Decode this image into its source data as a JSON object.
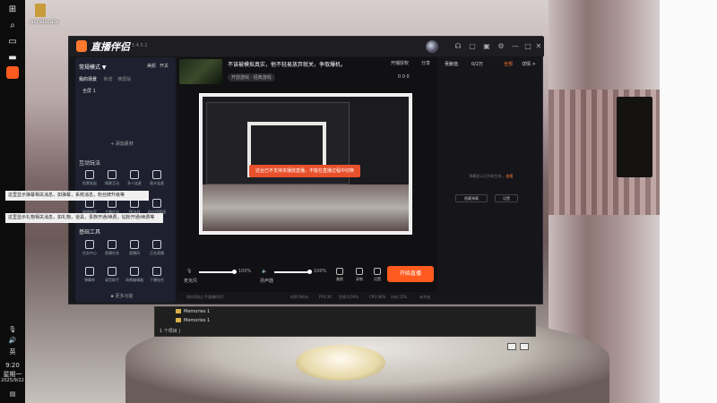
{
  "desktop": {
    "file_label": ".accelerate"
  },
  "taskbar": {
    "time": "9:20",
    "weekday": "星期一",
    "date": "2025/9/22",
    "lang": "英"
  },
  "app": {
    "name": "直播伴侣",
    "version": "5.4.5.2",
    "mode_label": "常规模式 ▼",
    "beauty_label": "美颜",
    "settings_label": "开关",
    "scene_tabs": [
      "我的场景",
      "新增",
      "横屏版"
    ],
    "scene_item": "全屏 1",
    "add_material": "+ 添加素材",
    "interactive_title": "互动玩法",
    "interactive_tools": [
      "投票发起",
      "情景互动",
      "多人连麦",
      "观众连麦",
      "福袋抽奖",
      "主播任务",
      "PK连线",
      "粉丝团管理"
    ],
    "basic_tools_title": "基础工具",
    "basic_tools": [
      "任务中心",
      "直播任务",
      "直播间",
      "正在直播",
      "弹幕库",
      "录音助手",
      "场景编辑器",
      "下播电台"
    ],
    "more_features": "▪ 更多功能",
    "stream_title": "不该被模拟真实，他不轻易放弃就关，争取爆机。",
    "category_tag": "开放游戏 · 经典游戏",
    "top_buttons": [
      "开播授权",
      "分享"
    ],
    "top_stats": "0   0   0",
    "toast": "这台已不支持本播放直播，不能在直播过程中切换",
    "controls": {
      "mic_label": "麦克风",
      "mic_volume": "100%",
      "speaker_label": "扬声器",
      "speaker_volume": "100%",
      "buttons": [
        "美颜",
        "录制",
        "设置"
      ],
      "go_live": "开始直播"
    },
    "status": [
      "如何添加上手直播伴侣?",
      "码率:0kb/s",
      "FPS:30",
      "丢帧:0.00%",
      "CPU:46%",
      "内存:22%",
      "未开启"
    ],
    "right_tabs": [
      "贡献值",
      "0/2万",
      "全部",
      "详情 >"
    ],
    "chat_empty": "弹幕显示已开始生效...",
    "chat_empty_link": "查看",
    "right_buttons": [
      "隐藏弹幕",
      "设置"
    ]
  },
  "tips": [
    "这里显示弹幕相关消息，如弹幕，系统消息，粉丝牌升级等",
    "这里显示礼物相关消息，如礼物，道具，贵族开通/续费，钻粉开通/续费等"
  ],
  "explorer": {
    "rows": [
      "Memories 1",
      "Memories 1"
    ],
    "footer": "1 个项目 |"
  }
}
